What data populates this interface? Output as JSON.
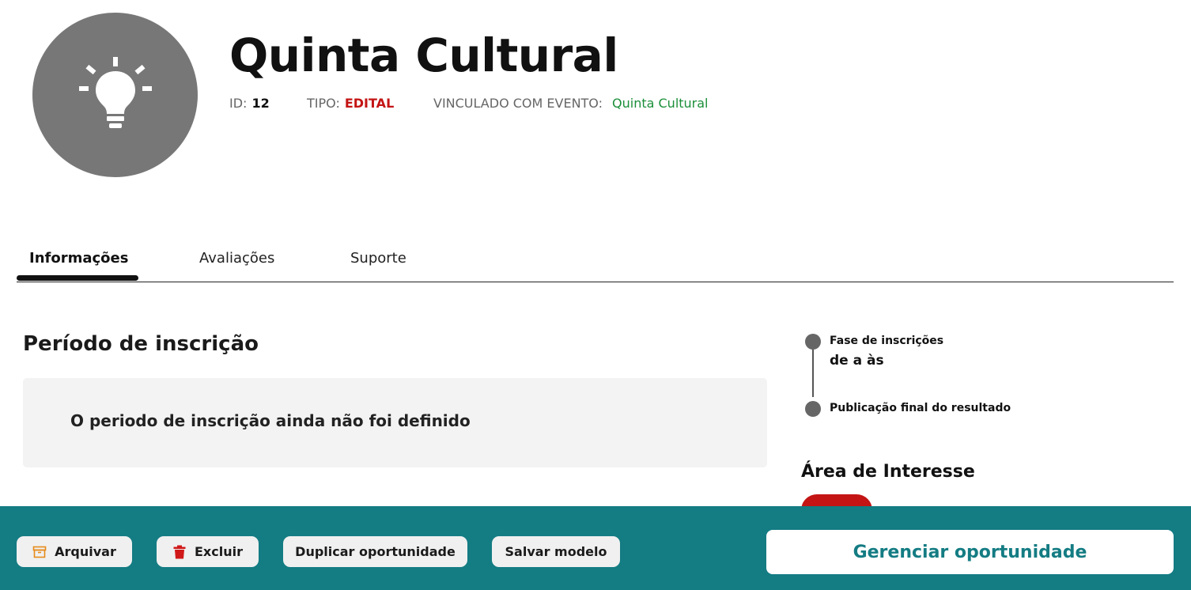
{
  "header": {
    "title": "Quinta Cultural",
    "avatar_icon": "lightbulb-icon",
    "avatar_color": "#777777",
    "id_label": "ID:",
    "id_value": "12",
    "type_label": "TIPO:",
    "type_value": "EDITAL",
    "event_label": "VINCULADO COM EVENTO:",
    "event_value": "Quinta Cultural"
  },
  "tabs": [
    {
      "label": "Informações",
      "active": true
    },
    {
      "label": "Avaliações",
      "active": false
    },
    {
      "label": "Suporte",
      "active": false
    }
  ],
  "period": {
    "title": "Período de inscrição",
    "notice": "O periodo de inscrição ainda não foi definido"
  },
  "timeline": {
    "phase1_label": "Fase de inscrições",
    "phase1_date": "de a às",
    "phase2_label": "Publicação final do resultado"
  },
  "interest": {
    "title": "Área de Interesse"
  },
  "footer": {
    "archive_label": "Arquivar",
    "delete_label": "Excluir",
    "duplicate_label": "Duplicar oportunidade",
    "save_template_label": "Salvar modelo",
    "manage_label": "Gerenciar oportunidade"
  },
  "colors": {
    "brand": "#147c83",
    "type_accent": "#c41414",
    "event_link": "#1b8f3a",
    "archive_icon": "#e68a1a",
    "delete_icon": "#d01818"
  }
}
